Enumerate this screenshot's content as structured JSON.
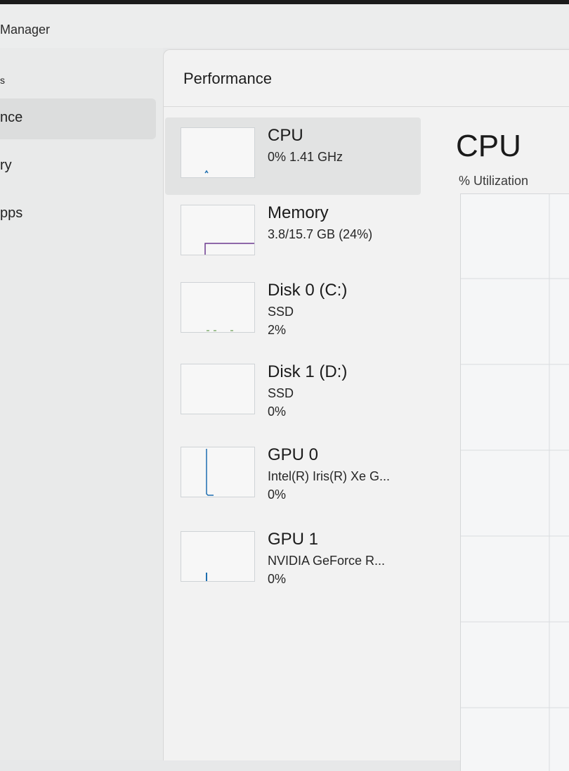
{
  "window": {
    "title": "Manager"
  },
  "sidebar": {
    "items": [
      {
        "label": "s"
      },
      {
        "label": "nce",
        "selected": true
      },
      {
        "label": "ry"
      },
      {
        "label": "pps"
      }
    ]
  },
  "main": {
    "title": "Performance",
    "items": [
      {
        "name": "CPU",
        "line1": "0% 1.41 GHz",
        "line2": "",
        "selected": true,
        "accent": "#1e6fb0",
        "utilization_percent": 0
      },
      {
        "name": "Memory",
        "line1": "3.8/15.7 GB (24%)",
        "line2": "",
        "selected": false,
        "accent": "#6d3a8f",
        "utilization_percent": 24
      },
      {
        "name": "Disk 0 (C:)",
        "line1": "SSD",
        "line2": "2%",
        "selected": false,
        "accent": "#4a8a2e",
        "utilization_percent": 2
      },
      {
        "name": "Disk 1 (D:)",
        "line1": "SSD",
        "line2": "0%",
        "selected": false,
        "accent": "#4a8a2e",
        "utilization_percent": 0
      },
      {
        "name": "GPU 0",
        "line1": "Intel(R) Iris(R) Xe G...",
        "line2": "0%",
        "selected": false,
        "accent": "#1e6fb0",
        "utilization_percent": 0
      },
      {
        "name": "GPU 1",
        "line1": "NVIDIA GeForce R...",
        "line2": "0%",
        "selected": false,
        "accent": "#1e6fb0",
        "utilization_percent": 0
      }
    ],
    "detail": {
      "title": "CPU",
      "subtitle": "% Utilization"
    }
  }
}
